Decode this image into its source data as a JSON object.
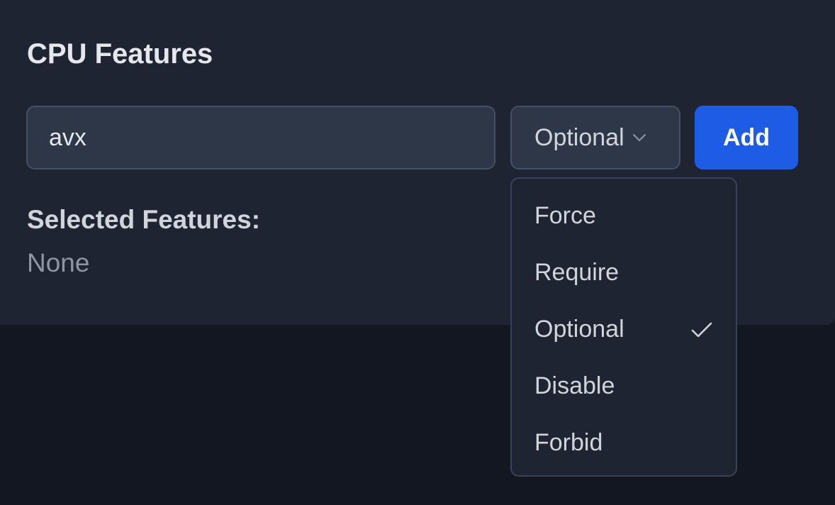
{
  "section": {
    "title": "CPU Features"
  },
  "feature_input": {
    "value": "avx",
    "placeholder": ""
  },
  "mode_select": {
    "selected": "Optional",
    "icon": "chevron-down-icon"
  },
  "add_button": {
    "label": "Add",
    "color": "#1f5ce6"
  },
  "selected_features": {
    "label": "Selected Features:",
    "value": "None"
  },
  "dropdown": {
    "items": [
      {
        "label": "Force",
        "selected": false
      },
      {
        "label": "Require",
        "selected": false
      },
      {
        "label": "Optional",
        "selected": true
      },
      {
        "label": "Disable",
        "selected": false
      },
      {
        "label": "Forbid",
        "selected": false
      }
    ],
    "selected_icon": "check-icon"
  },
  "colors": {
    "page_background": "#131722",
    "card_background": "#1e2431",
    "input_background": "#2e3748",
    "accent": "#1f5ce6"
  }
}
